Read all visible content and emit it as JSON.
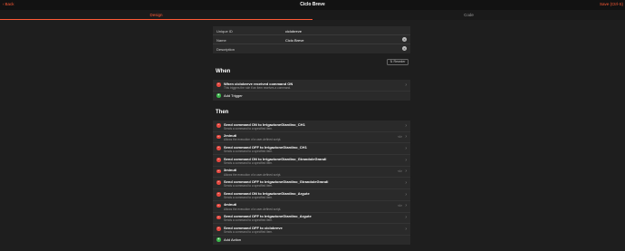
{
  "header": {
    "back_label": "Back",
    "title": "Ciclo Breve",
    "save_label": "Save (Ctrl-S)"
  },
  "tabs": [
    {
      "label": "Design",
      "active": true
    },
    {
      "label": "Code",
      "active": false
    }
  ],
  "properties": {
    "uid_label": "Unique ID",
    "uid_value": "ciclobreve",
    "name_label": "Name",
    "name_value": "Ciclo Breve",
    "description_label": "Description",
    "description_value": ""
  },
  "reorder_label": "⇅ Reorder",
  "when": {
    "title": "When",
    "triggers": [
      {
        "label": "When ciclobreve received command ON",
        "description": "This triggers the rule if an item receives a command."
      }
    ],
    "add_label": "Add Trigger"
  },
  "then": {
    "title": "Then",
    "actions": [
      {
        "label": "Send command ON to IrrigazioneGiardino_CH1",
        "description": "Sends a command to a specified item.",
        "code": ""
      },
      {
        "label": "2minuti",
        "description": "Allows the execution of a user-defined script.",
        "code": "</>"
      },
      {
        "label": "Send command OFF to IrrigazioneGiardino_CH1",
        "description": "Sends a command to a specified item.",
        "code": ""
      },
      {
        "label": "Send command ON to IrrigazioneGiardino_GirandoleGrandi",
        "description": "Sends a command to a specified item.",
        "code": ""
      },
      {
        "label": "3minuti",
        "description": "Allows the execution of a user-defined script.",
        "code": "</>"
      },
      {
        "label": "Send command OFF to IrrigazioneGiardino_GirandoleGrandi",
        "description": "Sends a command to a specified item.",
        "code": ""
      },
      {
        "label": "Send command ON to IrrigazioneGiardino_Argute",
        "description": "Sends a command to a specified item.",
        "code": ""
      },
      {
        "label": "4minuti",
        "description": "Allows the execution of a user-defined script.",
        "code": "</>"
      },
      {
        "label": "Send command OFF to IrrigazioneGiardino_Argute",
        "description": "Sends a command to a specified item.",
        "code": ""
      },
      {
        "label": "Send command OFF to ciclobreve",
        "description": "Sends a command to a specified item.",
        "code": ""
      }
    ],
    "add_label": "Add Action"
  },
  "colors": {
    "accent": "#ff5a36",
    "remove": "#e5483f",
    "add": "#3bb54a",
    "background": "#1e1e1e",
    "panel": "#2a2a2a"
  }
}
